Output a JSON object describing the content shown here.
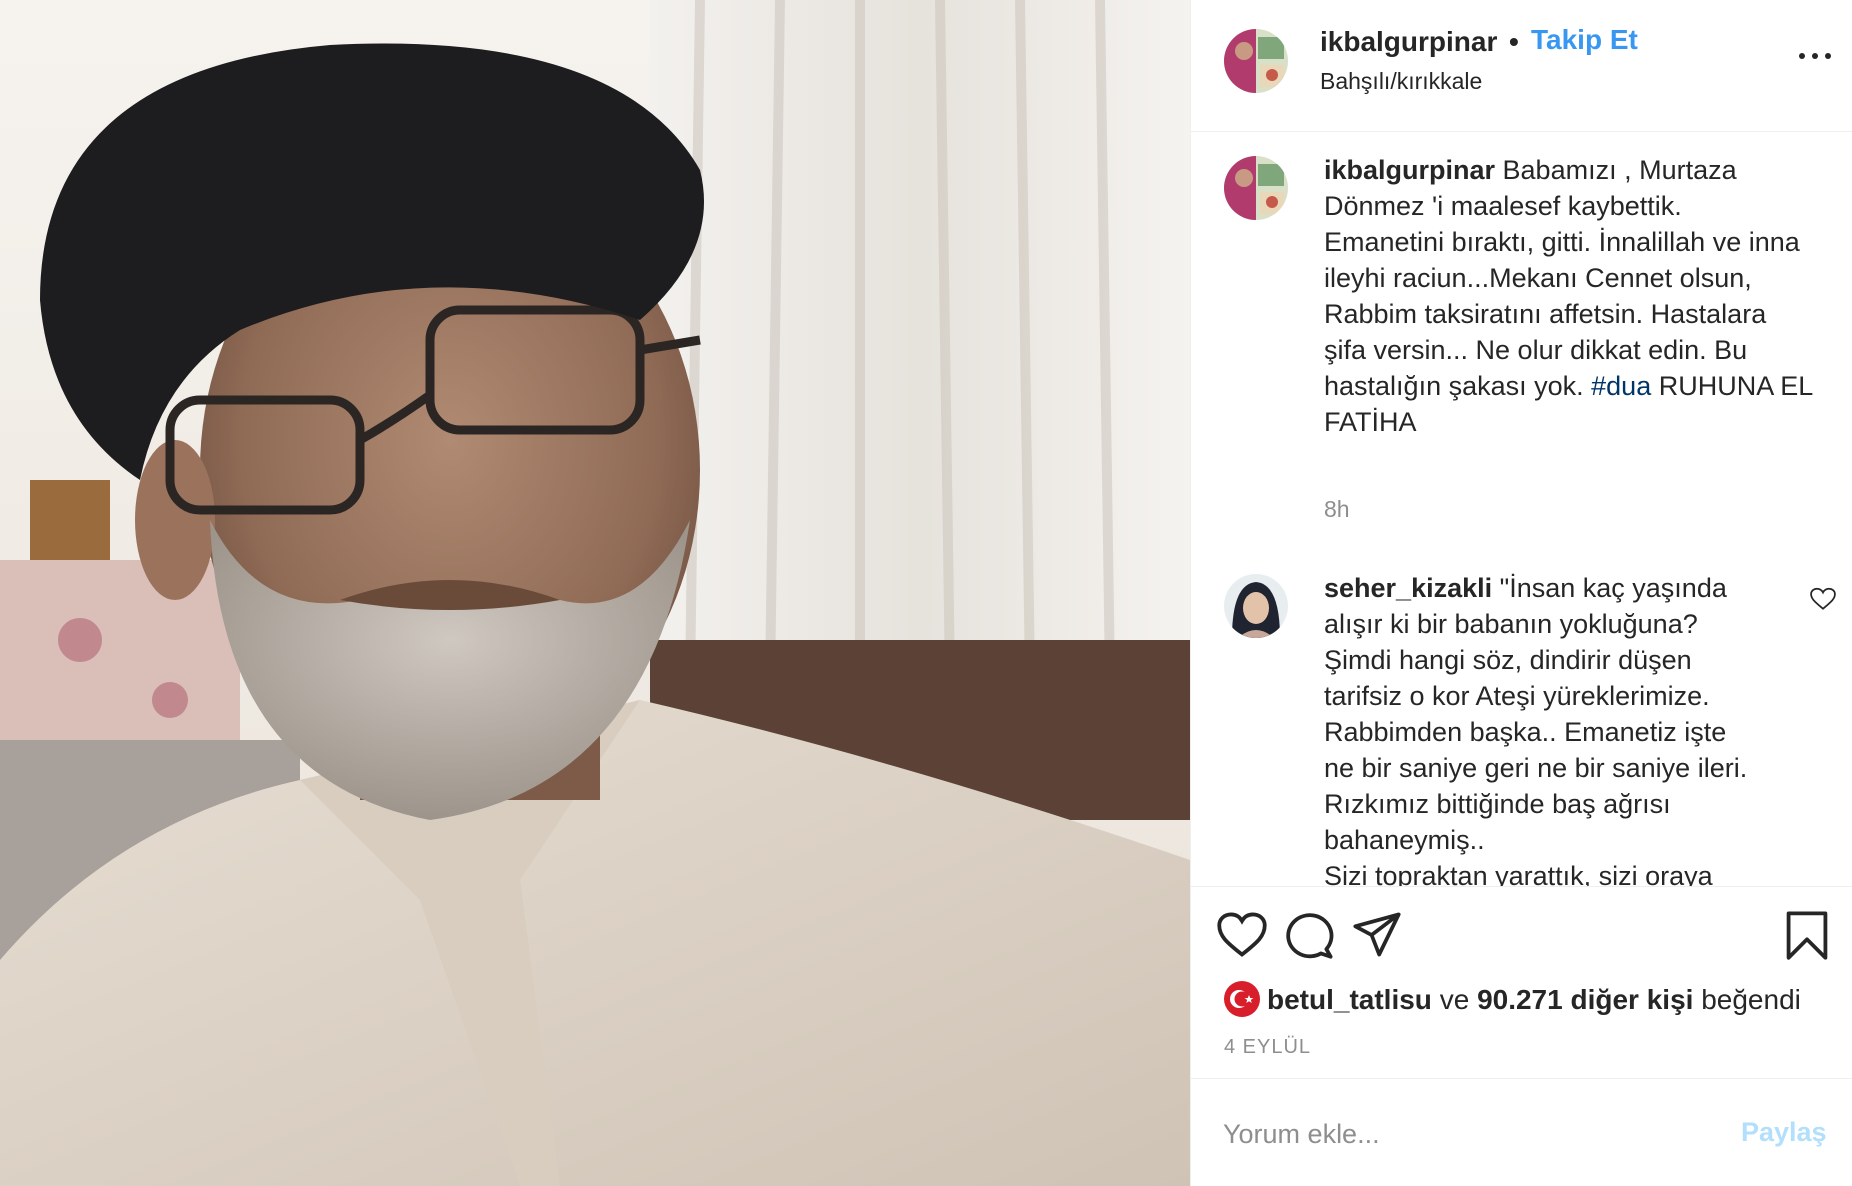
{
  "post": {
    "username": "ikbalgurpinar",
    "dot": "•",
    "follow_label": "Takip Et",
    "location": "Bahşılı/kırıkkale",
    "more_icon": "more-horizontal-icon"
  },
  "caption": {
    "username": "ikbalgurpinar",
    "text_before": " Babamızı , Murtaza\nDönmez 'i maalesef kaybettik.\nEmanetini bıraktı, gitti. İnnalillah ve inna\nileyhi raciun...Mekanı Cennet olsun,\nRabbim taksiratını affetsin. Hastalara\nşifa versin... Ne olur dikkat edin. Bu\nhastalığın şakası yok. ",
    "hashtag": "#dua",
    "text_after": " RUHUNA EL\nFATİHA",
    "time": "8h"
  },
  "comment": {
    "username": "seher_kizakli",
    "text": " \"İnsan kaç yaşında\nalışır ki bir babanın yokluğuna?\nŞimdi hangi söz, dindirir düşen\ntarifsiz o kor Ateşi yüreklerimize.\nRabbimden başka.. Emanetiz işte\nne bir saniye geri ne bir saniye ileri.\nRızkımız bittiğinde baş ağrısı\nbahaneymiş..\nSizi topraktan yarattık, sizi oraya"
  },
  "actions": {
    "like_icon": "heart-icon",
    "comment_icon": "comment-icon",
    "share_icon": "paper-plane-icon",
    "save_icon": "bookmark-icon"
  },
  "likes": {
    "liker": "betul_tatlisu",
    "connector": " ve ",
    "count_text": "90.271 diğer kişi",
    "suffix": " beğendi"
  },
  "date": "4 EYLÜL",
  "comment_input": {
    "placeholder": "Yorum ekle...",
    "share_label": "Paylaş"
  },
  "colors": {
    "link_blue": "#3897f0",
    "hashtag_blue": "#003569",
    "disabled_blue": "#b2dffc",
    "muted": "#8e8e8e"
  }
}
